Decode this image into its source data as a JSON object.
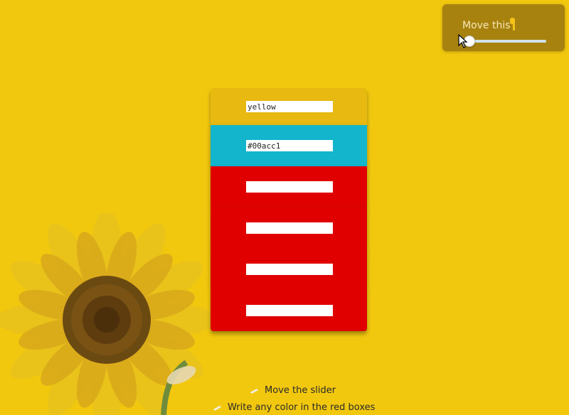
{
  "slider_panel": {
    "title": "Move this",
    "icon": "pointing-hand-icon",
    "slider_value": 0.03
  },
  "color_boxes": [
    {
      "value": "yellow",
      "background": "#e7b911"
    },
    {
      "value": "#00acc1",
      "background": "#13b5cd"
    },
    {
      "value": "",
      "background": "#e00000"
    },
    {
      "value": "",
      "background": "#e00000"
    },
    {
      "value": "",
      "background": "#e00000"
    },
    {
      "value": "",
      "background": "#e00000"
    }
  ],
  "instructions": [
    {
      "text": "Move the slider",
      "icon": "pencil-icon"
    },
    {
      "text": "Write any color in the red boxes",
      "icon": "pencil-icon"
    }
  ],
  "colors": {
    "page_background": "#f2c80f",
    "panel_background": "#a8820f",
    "red_box": "#e00000"
  }
}
